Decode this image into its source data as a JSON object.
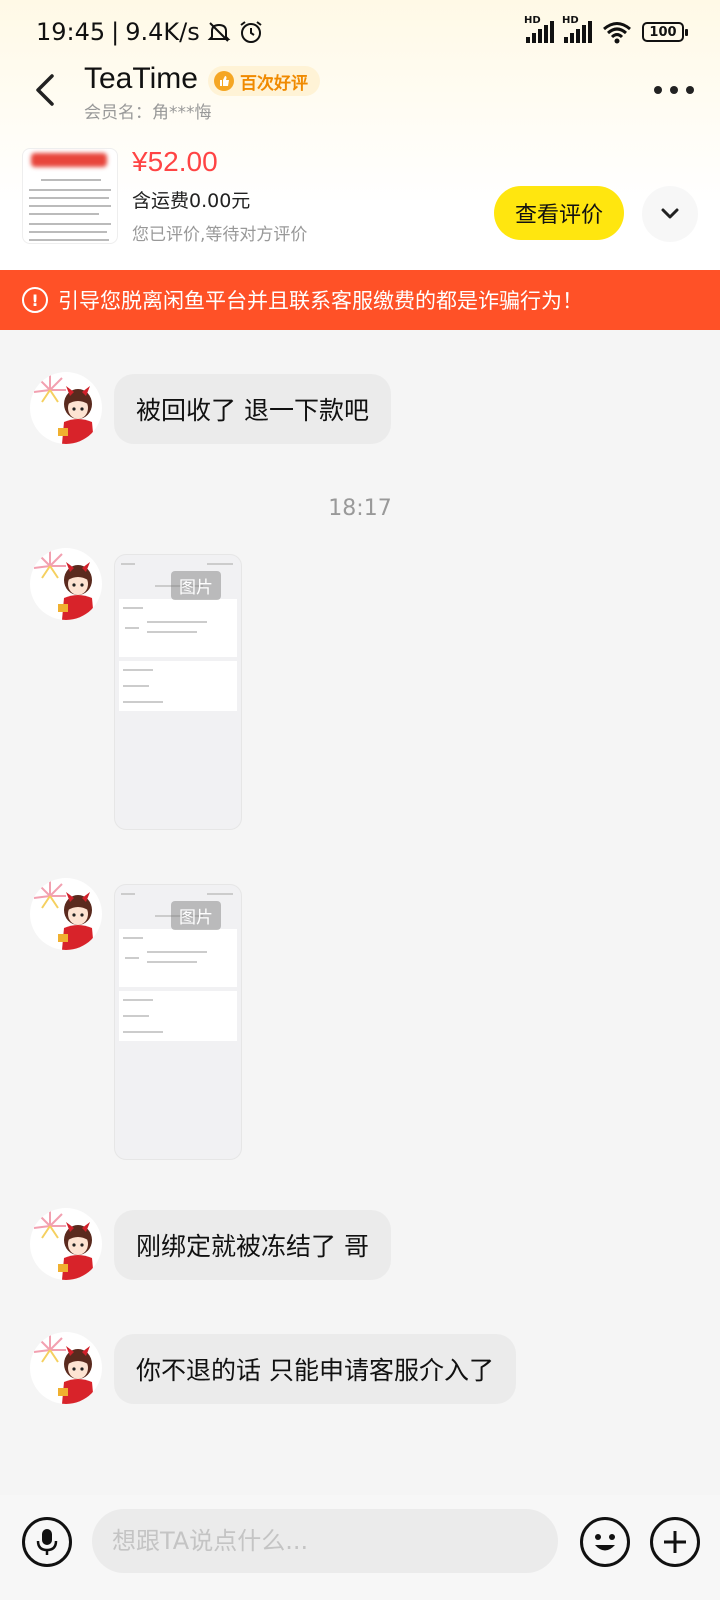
{
  "status_bar": {
    "time": "19:45",
    "speed": "9.4K/s",
    "battery": "100",
    "hd_label": "HD"
  },
  "nav": {
    "title": "TeaTime",
    "badge": "百次好评",
    "member": "会员名：角***悔"
  },
  "product": {
    "price": "¥52.00",
    "shipping": "含运费0.00元",
    "review_status": "您已评价,等待对方评价",
    "review_button": "查看评价"
  },
  "warning": {
    "icon": "!",
    "text": "引导您脱离闲鱼平台并且联系客服缴费的都是诈骗行为！"
  },
  "chat": {
    "messages": [
      {
        "type": "text",
        "text": "被回收了 退一下款吧"
      },
      {
        "type": "time",
        "text": "18:17"
      },
      {
        "type": "image",
        "tag": "图片"
      },
      {
        "type": "image",
        "tag": "图片"
      },
      {
        "type": "text",
        "text": "刚绑定就被冻结了 哥"
      },
      {
        "type": "text",
        "text": "你不退的话 只能申请客服介入了"
      }
    ]
  },
  "input": {
    "placeholder": "想跟TA说点什么..."
  },
  "colors": {
    "warning_bg": "#ff5127",
    "price": "#ff4444",
    "review_button": "#ffe60f",
    "badge_text": "#f08a00"
  }
}
